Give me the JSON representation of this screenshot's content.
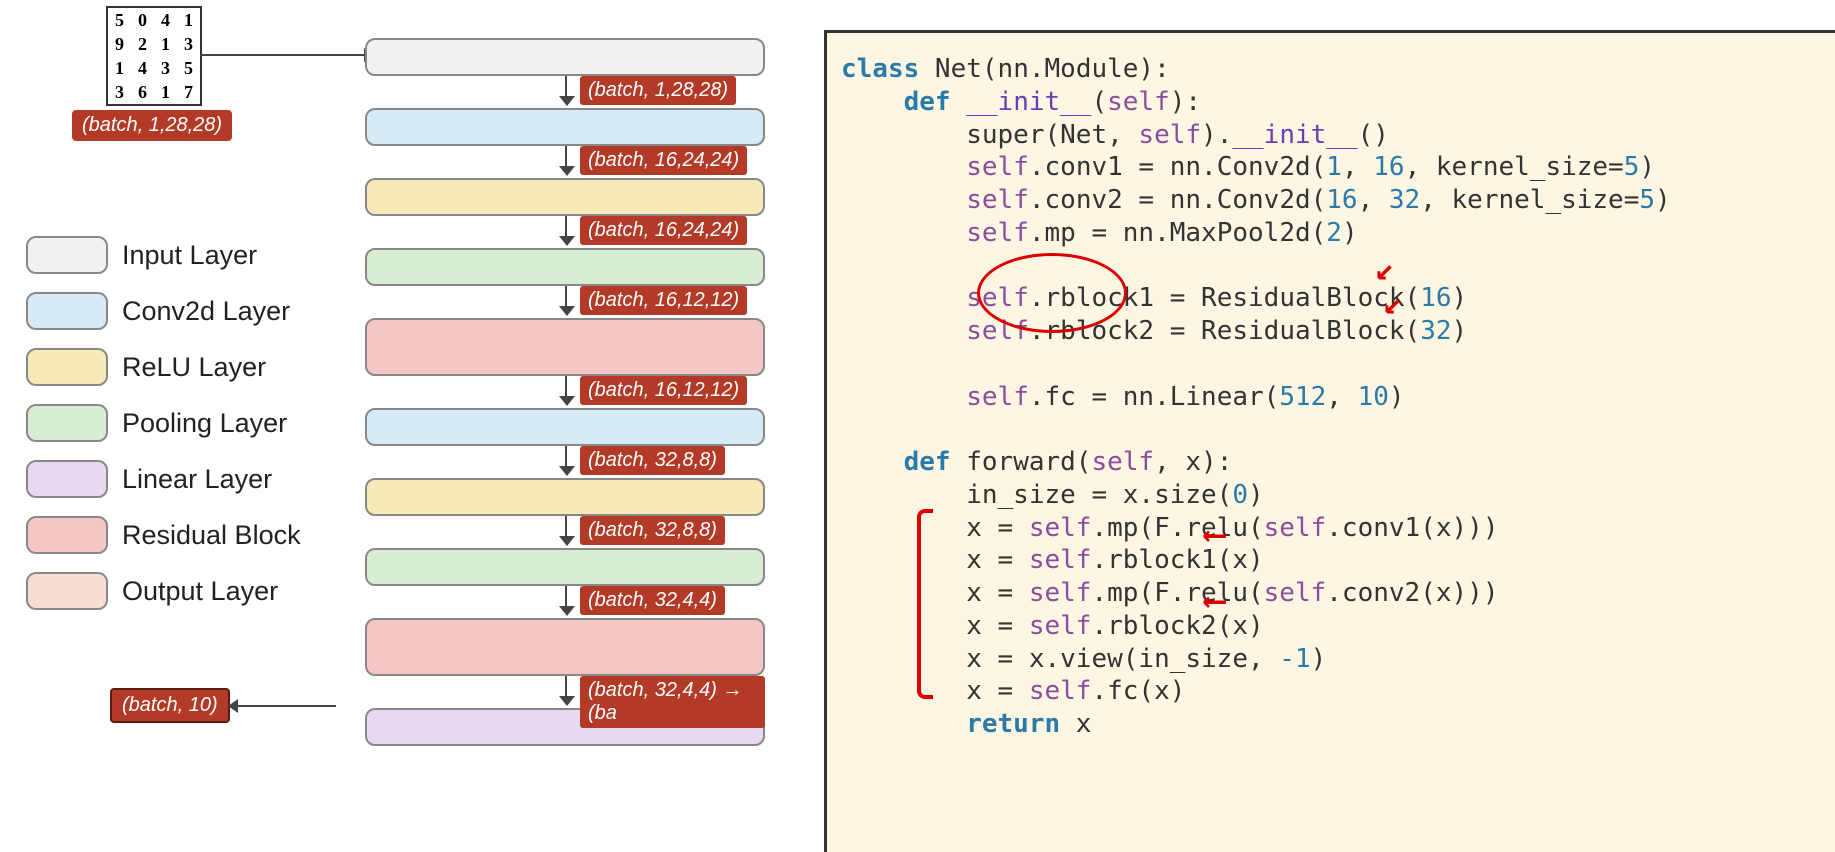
{
  "mnist_digits": [
    "5",
    "0",
    "4",
    "1",
    "9",
    "2",
    "1",
    "3",
    "1",
    "4",
    "3",
    "5",
    "3",
    "6",
    "1",
    "7"
  ],
  "input_shape": "(batch, 1,28,28)",
  "legend": [
    {
      "label": "Input Layer",
      "class": "c-input"
    },
    {
      "label": "Conv2d Layer",
      "class": "c-conv"
    },
    {
      "label": "ReLU Layer",
      "class": "c-relu"
    },
    {
      "label": "Pooling Layer",
      "class": "c-pool"
    },
    {
      "label": "Linear Layer",
      "class": "c-linear"
    },
    {
      "label": "Residual Block",
      "class": "c-resid"
    },
    {
      "label": "Output Layer",
      "class": "c-output"
    }
  ],
  "layers": [
    {
      "class": "c-input",
      "out": "(batch, 1,28,28)"
    },
    {
      "class": "c-conv",
      "out": "(batch, 16,24,24)"
    },
    {
      "class": "c-relu",
      "out": "(batch, 16,24,24)"
    },
    {
      "class": "c-pool",
      "out": "(batch, 16,12,12)"
    },
    {
      "class": "c-resid",
      "out": "(batch, 16,12,12)",
      "tall": true
    },
    {
      "class": "c-conv",
      "out": "(batch, 32,8,8)"
    },
    {
      "class": "c-relu",
      "out": "(batch, 32,8,8)"
    },
    {
      "class": "c-pool",
      "out": "(batch, 32,4,4)"
    },
    {
      "class": "c-resid",
      "out": "(batch, 32,4,4) → (ba",
      "tall": true
    },
    {
      "class": "c-linear",
      "out": ""
    }
  ],
  "output_shape": "(batch, 10)",
  "code": {
    "l1a": "class",
    "l1b": " Net(nn.Module):",
    "l2a": "    def",
    "l2b": " __init__",
    "l2c": "(",
    "l2d": "self",
    "l2e": "):",
    "l3a": "        super(Net, ",
    "l3b": "self",
    "l3c": ").",
    "l3d": "__init__",
    "l3e": "()",
    "l4a": "        ",
    "l4b": "self",
    "l4c": ".conv1 = nn.Conv2d(",
    "l4d": "1",
    "l4e": ", ",
    "l4f": "16",
    "l4g": ", kernel_size=",
    "l4h": "5",
    "l4i": ")",
    "l5a": "        ",
    "l5b": "self",
    "l5c": ".conv2 = nn.Conv2d(",
    "l5d": "16",
    "l5e": ", ",
    "l5f": "32",
    "l5g": ", kernel_size=",
    "l5h": "5",
    "l5i": ")",
    "l6a": "        ",
    "l6b": "self",
    "l6c": ".mp = nn.MaxPool2d(",
    "l6d": "2",
    "l6e": ")",
    "l7": "",
    "l8a": "        ",
    "l8b": "self",
    "l8c": ".rblock1 = ResidualBlock(",
    "l8d": "16",
    "l8e": ")",
    "l9a": "        ",
    "l9b": "self",
    "l9c": ".rblock2 = ResidualBlock(",
    "l9d": "32",
    "l9e": ")",
    "l10": "",
    "l11a": "        ",
    "l11b": "self",
    "l11c": ".fc = nn.Linear(",
    "l11d": "512",
    "l11e": ", ",
    "l11f": "10",
    "l11g": ")",
    "l12": "",
    "l13a": "    def",
    "l13b": " forward(",
    "l13c": "self",
    "l13d": ", x):",
    "l14": "        in_size = x.size(",
    "l14b": "0",
    "l14c": ")",
    "l15a": "        x = ",
    "l15b": "self",
    "l15c": ".mp(F.relu(",
    "l15d": "self",
    "l15e": ".conv1(x)))",
    "l16a": "        x = ",
    "l16b": "self",
    "l16c": ".rblock1(x)",
    "l17a": "        x = ",
    "l17b": "self",
    "l17c": ".mp(F.relu(",
    "l17d": "self",
    "l17e": ".conv2(x)))",
    "l18a": "        x = ",
    "l18b": "self",
    "l18c": ".rblock2(x)",
    "l19a": "        x = x.view(in_size, ",
    "l19b": "-1",
    "l19c": ")",
    "l20a": "        x = ",
    "l20b": "self",
    "l20c": ".fc(x)",
    "l21a": "        return",
    "l21b": " x"
  }
}
